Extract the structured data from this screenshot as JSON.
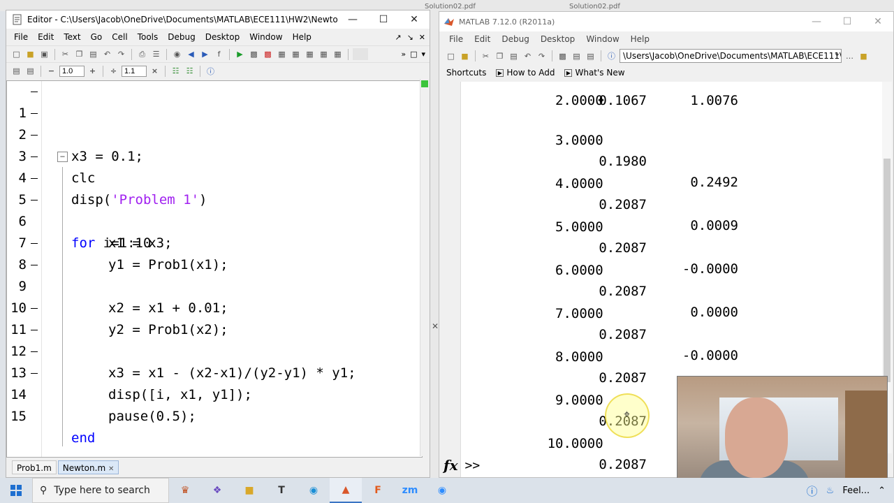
{
  "editor": {
    "title": "Editor - C:\\Users\\Jacob\\OneDrive\\Documents\\MATLAB\\ECE111\\HW2\\Newton.m",
    "menus": [
      "File",
      "Edit",
      "Text",
      "Go",
      "Cell",
      "Tools",
      "Debug",
      "Desktop",
      "Window",
      "Help"
    ],
    "cell_inputs": [
      "1.0",
      "1.1"
    ],
    "lines": [
      {
        "n": "1",
        "code": "x3 = 0.1;"
      },
      {
        "n": "2",
        "code": "clc"
      },
      {
        "n": "3",
        "code": "disp('Problem 1')"
      },
      {
        "n": "4",
        "code": "for i=1:10"
      },
      {
        "n": "5",
        "code": "x1 = x3;"
      },
      {
        "n": "6",
        "code": "y1 = Prob1(x1);"
      },
      {
        "n": "7",
        "code": ""
      },
      {
        "n": "8",
        "code": "x2 = x1 + 0.01;"
      },
      {
        "n": "9",
        "code": "y2 = Prob1(x2);"
      },
      {
        "n": "10",
        "code": ""
      },
      {
        "n": "11",
        "code": "x3 = x1 - (x2-x1)/(y2-y1) * y1;"
      },
      {
        "n": "12",
        "code": "disp([i, x1, y1]);"
      },
      {
        "n": "13",
        "code": "pause(0.5);"
      },
      {
        "n": "14",
        "code": "end"
      },
      {
        "n": "15",
        "code": ""
      }
    ],
    "tabs": [
      {
        "label": "Prob1.m",
        "active": false
      },
      {
        "label": "Newton.m",
        "active": true
      }
    ]
  },
  "matlab": {
    "title": "MATLAB 7.12.0 (R2011a)",
    "menus": [
      "File",
      "Edit",
      "Debug",
      "Desktop",
      "Window",
      "Help"
    ],
    "current_folder": "\\Users\\Jacob\\OneDrive\\Documents\\MATLAB\\ECE111\\HW2",
    "shortcuts": [
      "Shortcuts",
      "How to Add",
      "What's New"
    ],
    "console_rows": [
      [
        "3.0000",
        "0.1980",
        "0.2492"
      ],
      [
        "4.0000",
        "0.2087",
        "0.0009"
      ],
      [
        "5.0000",
        "0.2087",
        "-0.0000"
      ],
      [
        "6.0000",
        "0.2087",
        "0.0000"
      ],
      [
        "7.0000",
        "0.2087",
        "-0.0000"
      ],
      [
        "8.0000",
        "0.2087",
        "0.0000"
      ],
      [
        "9.0000",
        "0.2087",
        "-0.0000"
      ],
      [
        "10.0000",
        "0.2087",
        ""
      ]
    ],
    "prompt": ">>",
    "fx_label": "fx"
  },
  "taskbar": {
    "search_placeholder": "Type here to search",
    "tray_label": "Feel..."
  },
  "background_tabs": [
    "Solution02.pdf",
    "Solution02.pdf"
  ]
}
